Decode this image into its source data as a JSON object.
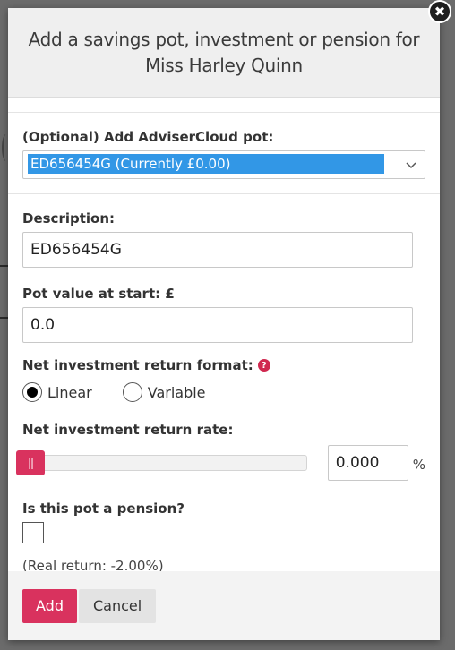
{
  "dialog": {
    "title": "Add a savings pot, investment or pension for Miss Harley Quinn",
    "close_glyph": "✖"
  },
  "adviser_pot": {
    "label": "(Optional) Add AdviserCloud pot:",
    "selected": "ED656454G (Currently £0.00)"
  },
  "description": {
    "label": "Description:",
    "value": "ED656454G"
  },
  "pot_value": {
    "label": "Pot value at start: £",
    "value": "0.0"
  },
  "return_format": {
    "label": "Net investment return format:",
    "help_glyph": "?",
    "options": [
      {
        "label": "Linear",
        "selected": true
      },
      {
        "label": "Variable",
        "selected": false
      }
    ]
  },
  "return_rate": {
    "label": "Net investment return rate:",
    "value": "0.000",
    "unit": "%",
    "slider_position_fraction": 0.0,
    "slider_handle_glyph": "||"
  },
  "pension": {
    "label": "Is this pot a pension?",
    "checked": false
  },
  "real_return": "(Real return: -2.00%)",
  "footer": {
    "add_label": "Add",
    "cancel_label": "Cancel"
  },
  "colors": {
    "accent": "#d9325e",
    "select_highlight": "#3297e6",
    "header_bg": "#efefef",
    "footer_bg": "#f3f3f3",
    "overlay": "#6b6b6b"
  }
}
